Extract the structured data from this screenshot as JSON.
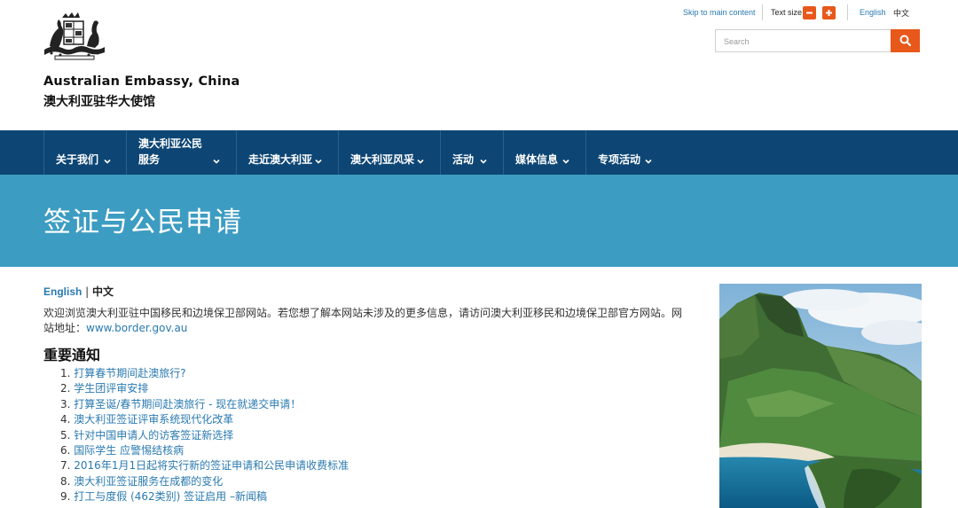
{
  "header": {
    "site_name": "Australian Embassy, China",
    "site_name_zh": "澳大利亚驻华大使馆",
    "skip_link": "Skip to main content",
    "text_size_label": "Text size",
    "text_minus": "−",
    "text_plus": "+",
    "lang_english": "English",
    "lang_chinese": "中文",
    "search_placeholder": "Search"
  },
  "nav": {
    "items": [
      {
        "label": "关于我们"
      },
      {
        "label": "澳大利亚公民",
        "label2": "服务"
      },
      {
        "label": "走近澳大利亚"
      },
      {
        "label": "澳大利亚风采"
      },
      {
        "label": "活动"
      },
      {
        "label": "媒体信息"
      },
      {
        "label": "专项活动"
      }
    ]
  },
  "banner": {
    "title": "签证与公民申请"
  },
  "content": {
    "lang_en": "English",
    "lang_sep": " | ",
    "lang_zh": "中文",
    "intro_line1": "欢迎浏览澳大利亚驻中国移民和边境保卫部网站。若您想了解本网站未涉及的更多信息，请访问澳大利亚移民和边境保卫部官方网站。网",
    "intro_line2_prefix": "站地址：",
    "intro_link": "www.border.gov.au",
    "notice_title": "重要通知",
    "notices": [
      {
        "num": "1.",
        "text": "打算春节期间赴澳旅行?"
      },
      {
        "num": "2.",
        "text": "学生团评审安排"
      },
      {
        "num": "3.",
        "text": "打算圣诞/春节期间赴澳旅行 - 现在就递交申请！"
      },
      {
        "num": "4.",
        "text": "澳大利亚签证评审系统现代化改革"
      },
      {
        "num": "5.",
        "text": "针对中国申请人的访客签证新选择"
      },
      {
        "num": "6.",
        "text": "国际学生 应警惕结核病"
      },
      {
        "num": "7.",
        "text": "2016年1月1日起将实行新的签证申请和公民申请收费标准"
      },
      {
        "num": "8.",
        "text": " 澳大利亚签证服务在成都的变化"
      },
      {
        "num": "9.",
        "text": "打工与度假 (462类别) 签证启用 –新闻稿"
      }
    ]
  },
  "colors": {
    "nav_bg": "#0d4674",
    "banner_bg": "#3d9cc2",
    "accent": "#e8581b",
    "link": "#2a7ab0"
  }
}
